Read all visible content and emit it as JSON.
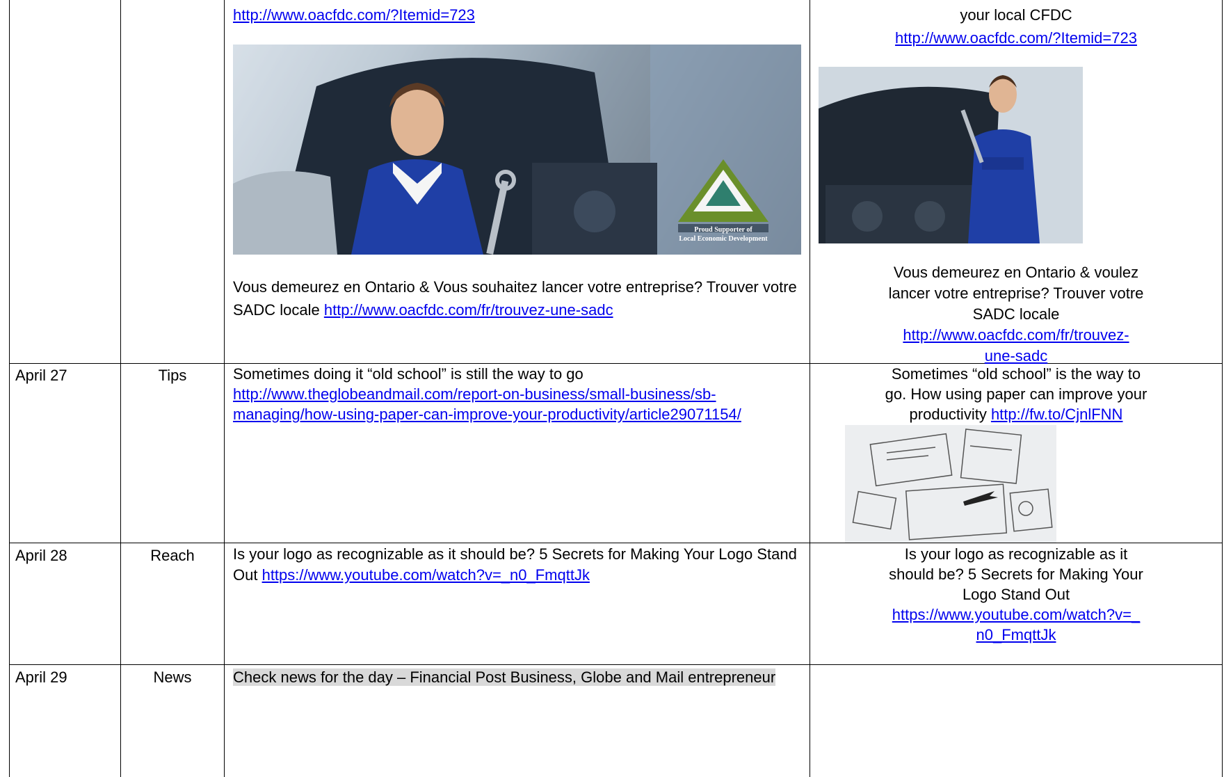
{
  "rows": [
    {
      "date": "",
      "category": "",
      "main": {
        "link_top": "http://www.oacfdc.com/?Itemid=723",
        "banner_logo_caption_1": "Proud Supporter of",
        "banner_logo_caption_2": "Local Economic Development",
        "text_fr": "Vous demeurez en Ontario & Vous souhaitez lancer votre entreprise? Trouver votre SADC locale ",
        "link_fr": "http://www.oacfdc.com/fr/trouvez-une-sadc"
      },
      "social": {
        "line1": "your local CFDC",
        "link1": "http://www.oacfdc.com/?Itemid=723",
        "text_fr_1": "Vous demeurez en Ontario & voulez",
        "text_fr_2": "lancer votre entreprise? Trouver votre",
        "text_fr_3": "SADC locale",
        "link_fr_1": "http://www.oacfdc.com/fr/trouvez-",
        "link_fr_2": "une-sadc"
      }
    },
    {
      "date": "April 27",
      "category": "Tips",
      "main": {
        "text": "Sometimes doing it “old school” is still the way to go",
        "link_1": "http://www.theglobeandmail.com/report-on-business/small-business/sb-",
        "link_2": "managing/how-using-paper-can-improve-your-productivity/article29071154/"
      },
      "social": {
        "line1": "Sometimes “old school” is the way to",
        "line2": "go. How using paper can improve your",
        "line3_text": "productivity ",
        "line3_link": "http://fw.to/CjnlFNN"
      }
    },
    {
      "date": "April 28",
      "category": "Reach",
      "main": {
        "text_1": "Is your logo as recognizable as it should be? 5 Secrets for Making Your Logo Stand",
        "text_2": "Out ",
        "link": "https://www.youtube.com/watch?v=_n0_FmqttJk"
      },
      "social": {
        "line1": "Is your logo as recognizable as it",
        "line2": "should be? 5 Secrets for Making Your",
        "line3": "Logo Stand Out",
        "link_1": "https://www.youtube.com/watch?v=_",
        "link_2": "n0_FmqttJk"
      }
    },
    {
      "date": "April 29",
      "category": "News",
      "main": {
        "text": "Check news for the day – Financial Post Business, Globe and Mail entrepreneur"
      },
      "social": {}
    }
  ],
  "colors": {
    "link": "#0000ee",
    "highlight": "#d9d9d9",
    "border": "#000000"
  }
}
